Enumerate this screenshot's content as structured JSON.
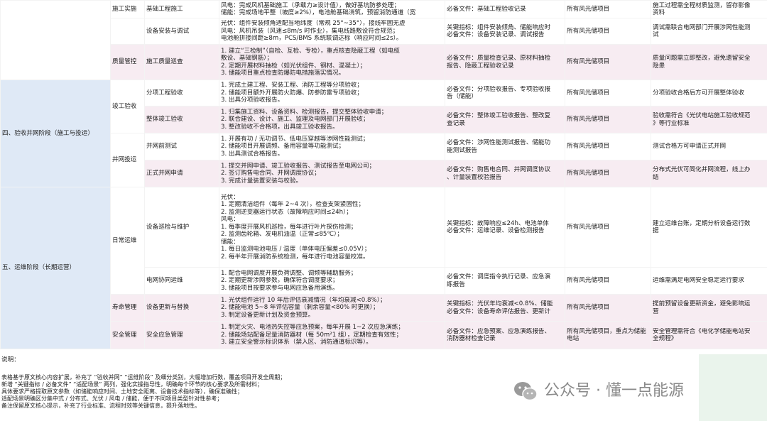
{
  "rows": [
    {
      "stage": "",
      "group": "施工实施",
      "item": "基础工程施工",
      "content": [
        "风电：完成风机基础施工（承载力≥设计值），做好基坑防参处理；",
        "储能：完成场地平整（坡度≥2%），电池舱基础浇筑，预留消防通道（宽"
      ],
      "docs": [
        "必备文件：基础工程验收记录"
      ],
      "scope": "所有风光储项目",
      "note": [
        "施工过程需全程材质监测，留存影像",
        "资料"
      ]
    },
    {
      "stage": "",
      "group": "",
      "item": "设备安装与调试",
      "content": [
        "光伏：组件安装倾角适配当地纬度（常规 25°~35°），接线牢固无虚",
        "风电：风机吊装（风速≤8m/s 时作业），集电线路敷设符合规范；",
        "电池舱拼接间距≥8m，PCS/BMS 系统联调达标（响应时间≤2s）。"
      ],
      "docs": [
        "关键指标：组件安装倾角、储能响应时",
        "必备文件：设备安装记录、调试报告"
      ],
      "scope": "所有风光储项目",
      "note": [
        "调试需联合电网部门开展涉网性能测",
        "试"
      ]
    },
    {
      "stage": "",
      "group": "质量管控",
      "item": "施工质量巡查",
      "content": [
        "1. 建立“三检制”（自检、互检、专检），重点核查隐蔽工程（如电缆",
        "敷设、基础钢筋）；",
        "2. 定期开展材料抽检（如光伏组件、钢材、混凝土）；",
        "3. 储能项目重点检查防爆防电措施落实情况。"
      ],
      "docs": [
        "必备文件：质量检查记录、原材料抽检",
        "报告、隐蔽工程验收记录"
      ],
      "scope": "所有风光储项目",
      "note": [
        "质量问题需立即整改，避免遗留安全",
        "隐患"
      ]
    },
    {
      "stage": "四、验收并网阶段（施工与投运）",
      "group": "竣工验收",
      "item": "分项工程验收",
      "content": [
        "1. 完成土建工程、安装工程、消防工程等分项验收；",
        "2. 储能项目额外开展防火防爆、防参防雷专项验收；",
        "3. 出具分项验收报告。"
      ],
      "docs": [
        "必备文件：分项验收报告、专项验收报",
        "告（储能）"
      ],
      "scope": "所有风光储项目",
      "note": [
        "分项验收合格后方可开展整体验收"
      ]
    },
    {
      "stage": "",
      "group": "",
      "item": "整体竣工验收",
      "content": [
        "1. 归集施工资料、设备资料、检测报告，提交整体验收申请；",
        "2. 联合建设、设计、施工、监理及电网部门开展验收；",
        "3. 整改验收不合格项，出具竣工验收报告。"
      ],
      "docs": [
        "必备文件：整体竣工验收报告、整改复",
        "查记录"
      ],
      "scope": "所有风光储项目",
      "note": [
        "验收需符合《光伏电站施工验收规范",
        "》等行业标准"
      ]
    },
    {
      "stage": "",
      "group": "并网投运",
      "item": "并网前测试",
      "content": [
        "1. 开展有功 / 无功调节、低电压穿越等涉网性能测试；",
        "2. 储能项目开展调频、备用容量等功能测试；",
        "3. 出具测试合格报告。"
      ],
      "docs": [
        "必备文件：涉网性能测试报告、储能功",
        "能测试报告"
      ],
      "scope": "所有风光储项目",
      "note": [
        "测试合格方可申请正式并网"
      ]
    },
    {
      "stage": "",
      "group": "",
      "item": "正式并网申请",
      "content": [
        "1. 提交并网申请、竣工验收报告、测试报告至电网公司；",
        "2. 签订购售电合同、并网调度协议；",
        "3. 完成计量装置安装与校验。"
      ],
      "docs": [
        "必备文件：购售电合同、并网调度协议",
        "、计量装置校验报告"
      ],
      "scope": "所有风光储项目",
      "note": [
        "分布式光伏可简化并网流程，线上办",
        "结"
      ]
    },
    {
      "stage": "五、运维阶段（长期运营）",
      "group": "日常运维",
      "item": "设备巡检与维护",
      "content": [
        "光伏：",
        "1. 定期清洁组件（每年 2~4 次），检查支架紧固性；",
        "2. 监测逆变器运行状态（故障响应时间≤24h）；",
        "风电：",
        "1. 每季度开展风机巡检，每年进行叶片探伤检测；",
        "2. 监测齿轮箱、发电机油温（正常≤85℃）；",
        "储能：",
        "1. 每日监测电池电压 / 温度（单体电压偏差≤0.05V）；",
        "2. 每半年开展消防系统检测，每年进行电池容量校准。"
      ],
      "docs": [
        "关键指标：故障响应≤24h、电池单体",
        "必备文件：运维记录、设备检测报告"
      ],
      "scope": "所有风光储项目",
      "note": [
        "建立运维台账，定期分析设备运行数",
        "据"
      ]
    },
    {
      "stage": "",
      "group": "",
      "item": "电网协同运维",
      "content": [
        "1. 配合电网调度开展负荷调整、调频等辅助服务；",
        "2. 定期更新涉网参数，确保符合调度要求；",
        "3. 储能项目按要求参与电网应急备用演练。"
      ],
      "docs": [
        "必备文件：调度指令执行记录、应急演",
        "练报告"
      ],
      "scope": "所有风光储项目",
      "note": [
        "运维需满足电网安全稳定运行要求"
      ]
    },
    {
      "stage": "",
      "group": "寿命管理",
      "item": "设备更新与替换",
      "content": [
        "1. 光伏组件运行 10 年后评估衰减情况（年均衰减<0.8%）；",
        "2. 储能电池 5~8 年评估容量（剩余容量<80% 时更换）；",
        "3. 制定设备更新计划及资金预算。"
      ],
      "docs": [
        "关键指标：光伏年均衰减<0.8%、储能",
        "必备文件：设备寿命评估报告、更新计"
      ],
      "scope": "所有风光储项目",
      "note": [
        "提前预留设备更新资金，避免影响运",
        "营"
      ]
    },
    {
      "stage": "",
      "group": "安全管理",
      "item": "安全应急管理",
      "content": [
        "1. 制定火灾、电池热失控等应急预案，每年开展 1~2 次应急演练；",
        "2. 储能场站配备足量消防器材（每 50m²1 组），定期检查有效性；",
        "3. 建立安全警示标识体系（禁入区、消防通道标识等）。"
      ],
      "docs": [
        "必备文件：应急预案、应急演练报告、",
        "消防器材检查记录"
      ],
      "scope": "所有风光储项目，重点为储能电站",
      "note": [
        "安全管理需符合《电化学储能电站安",
        "全规程》"
      ]
    }
  ],
  "footer": {
    "title": "说明：",
    "lines": [
      "表格基于原文核心内容扩展，补充了 “验收并网” “运维阶段” 及细分类别，大幅增加行数，覆盖项目开发全周期；",
      "新增 “关键指标 / 必备文件” “适配场景” 两列，强化实操指导性，明确每个环节的核心要求及所需材料；",
      "具体要求严格提取原文参数（如储能响应时间、土地安全距离、设备技术指标等），确保准确性；",
      "适配场景明确区分集中式 / 分布式、光伏 / 风电 / 储能，便于不同项目类型针对性参考；",
      "备注保留原文核心提示，补充了行业标准、流程时效等关键信息，提升落地性。"
    ]
  },
  "watermark": {
    "text": "公众号 · 懂一点能源",
    "icon": "wechat-icon"
  }
}
